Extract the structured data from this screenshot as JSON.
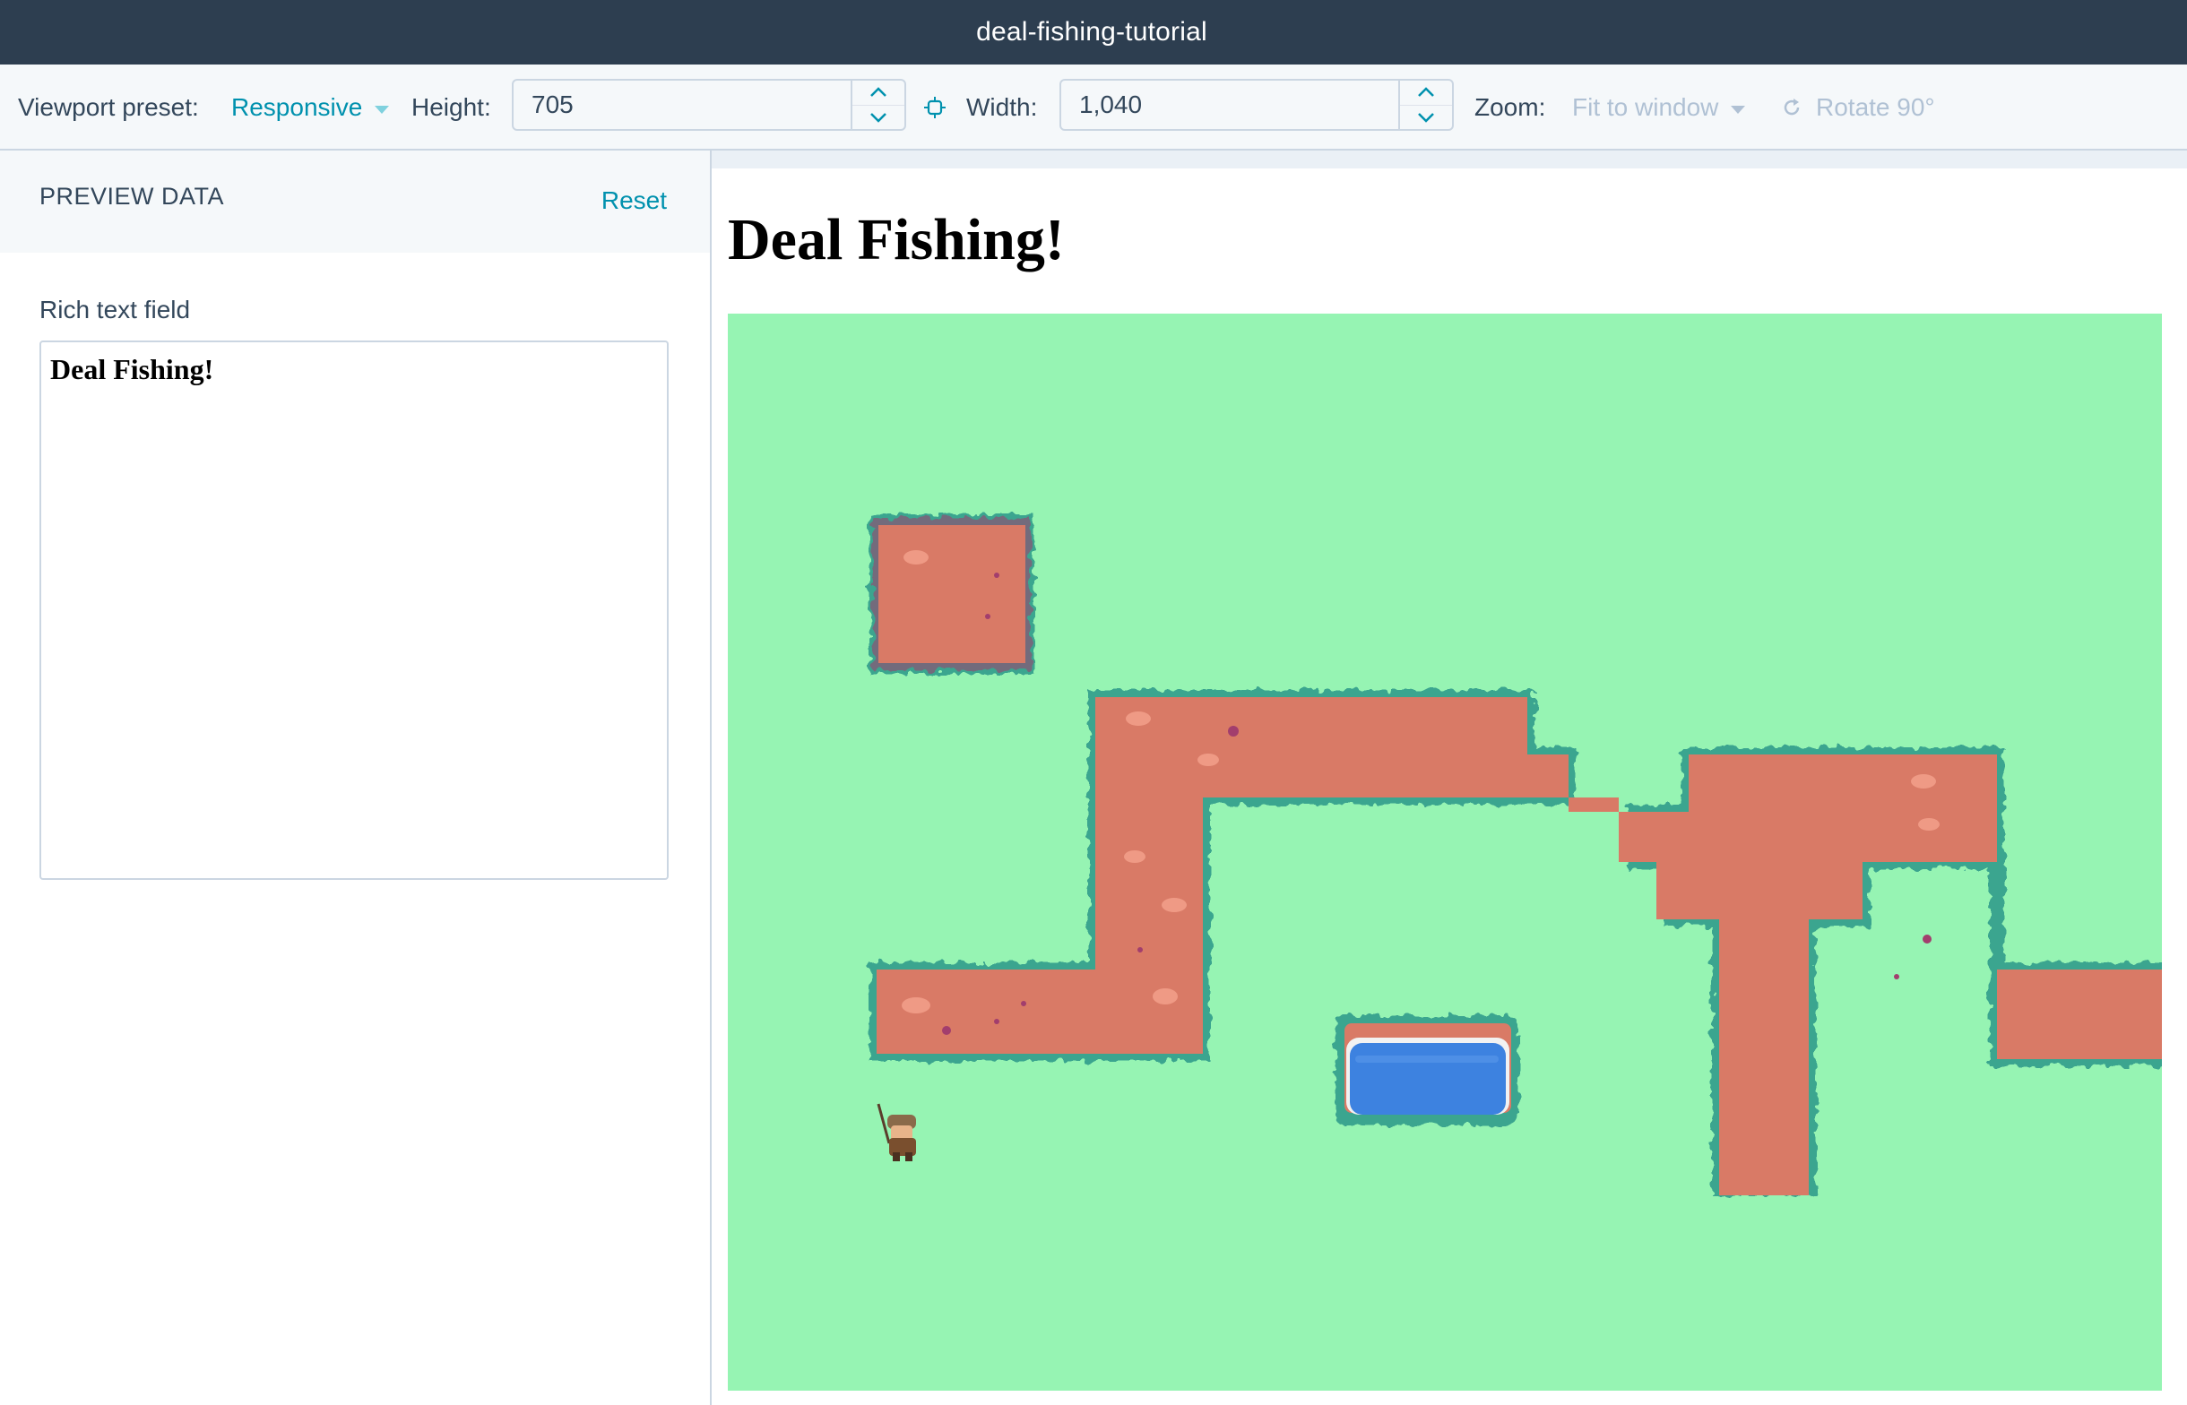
{
  "window": {
    "title": "deal-fishing-tutorial"
  },
  "toolbar": {
    "viewport_label": "Viewport preset:",
    "viewport_value": "Responsive",
    "height_label": "Height:",
    "height_value": "705",
    "width_label": "Width:",
    "width_value": "1,040",
    "zoom_label": "Zoom:",
    "zoom_value": "Fit to window",
    "rotate_label": "Rotate 90°"
  },
  "left_panel": {
    "title": "PREVIEW DATA",
    "reset_label": "Reset",
    "field_label": "Rich text field",
    "field_value": "Deal Fishing!"
  },
  "preview": {
    "heading": "Deal Fishing!"
  },
  "colors": {
    "titlebar": "#2d3e50",
    "accent": "#0091ae",
    "grass": "#96f4b3",
    "dirt": "#d97a66",
    "bush_edge": "#3aa58f",
    "water": "#3d82e0"
  }
}
